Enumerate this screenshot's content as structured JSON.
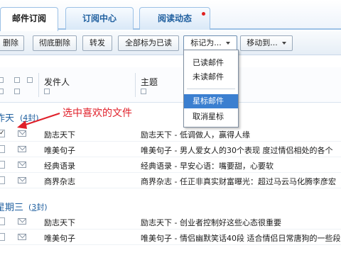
{
  "tabs": [
    {
      "label": "邮件订阅",
      "active": true
    },
    {
      "label": "订阅中心",
      "active": false
    },
    {
      "label": "阅读动态",
      "active": false,
      "has_dot": true
    }
  ],
  "toolbar": {
    "delete": "删除",
    "perm_delete": "彻底删除",
    "forward": "转发",
    "mark_all_read": "全部标为已读",
    "mark_as": "标记为...",
    "move_to": "移动到..."
  },
  "mark_menu": {
    "items": [
      "已读邮件",
      "未读邮件",
      "星标邮件",
      "取消星标"
    ],
    "selected_index": 2
  },
  "columns": {
    "sender": "发件人",
    "subject": "主题"
  },
  "groups": [
    {
      "label": "昨天",
      "count_prefix": "(",
      "count_num": "4",
      "count_suffix": "封)"
    },
    {
      "label": "星期三",
      "count_prefix": "(",
      "count_num": "3",
      "count_suffix": "封)"
    }
  ],
  "emails_group1": [
    {
      "sender": "励志天下",
      "subject": "励志天下 - 低调做人，赢得人缘",
      "checked": true
    },
    {
      "sender": "唯美句子",
      "subject": "唯美句子 - 男人爱女人的30个表现   度过情侣相处的各个",
      "checked": false
    },
    {
      "sender": "经典语录",
      "subject": "经典语录 - 早安心语：嘴要甜，心要软",
      "checked": false
    },
    {
      "sender": "商界杂志",
      "subject": "商界杂志 - 任正非真实财富曝光：超过马云马化腾李彦宏",
      "checked": false
    }
  ],
  "emails_group2": [
    {
      "sender": "励志天下",
      "subject": "励志天下 - 创业者控制好这些心态很重要",
      "checked": false
    },
    {
      "sender": "唯美句子",
      "subject": "唯美句子 - 情侣幽默笑话40段 适合情侣日常唐狗的一些段",
      "checked": false
    }
  ],
  "annotation": "选中喜欢的文件",
  "colors": {
    "accent": "#1f5f9f",
    "menu_highlight": "#3b7fd0",
    "annotation": "#e0202a"
  }
}
